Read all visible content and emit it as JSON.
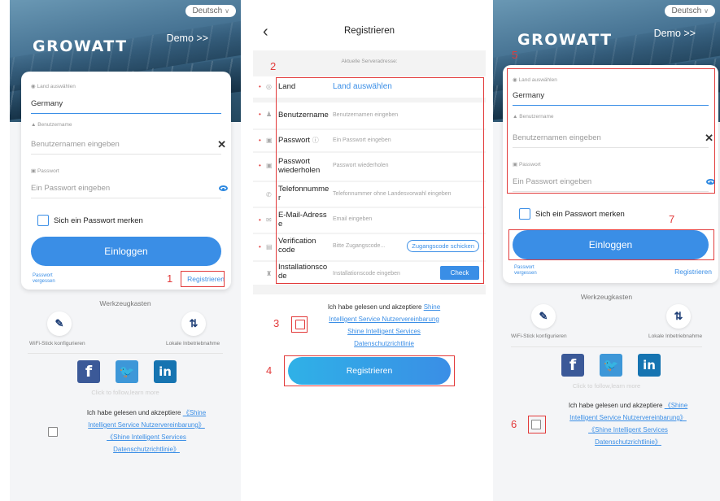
{
  "login": {
    "language": "Deutsch",
    "logo": "GROWATT",
    "demo": "Demo >>",
    "country_label": "Land auswählen",
    "country_value": "Germany",
    "username_label": "Benutzername",
    "username_placeholder": "Benutzernamen eingeben",
    "password_label": "Passwort",
    "password_placeholder": "Ein Passwort eingeben",
    "remember": "Sich ein Passwort merken",
    "login_button": "Einloggen",
    "forgot_line1": "Passwort",
    "forgot_line2": "vergessen",
    "register": "Registrieren",
    "tools_title": "Werkzeugkasten",
    "tool_wifi": "WiFi-Stick konfigurieren",
    "tool_local": "Lokale Inbetriebnahme",
    "follow": "Click to follow,learn more",
    "agree_line1_text": "Ich habe gelesen und akzeptiere",
    "agree_line1_link": "《Shine",
    "agree_line2": "Intelligent Service Nutzervereinbarung》",
    "agree_line3": "《Shine Intelligent Services",
    "agree_line4": "Datenschutzrichtlinie》"
  },
  "register_page": {
    "title": "Registrieren",
    "server": "Aktuelle Serveradresse:",
    "rows": [
      {
        "label": "Land",
        "value": "Land auswählen"
      },
      {
        "label": "Benutzername",
        "value": "Benutzernamen eingeben"
      },
      {
        "label": "Passwort",
        "value": "Ein Passwort eingeben"
      },
      {
        "label": "Passwort wiederholen",
        "value": "Passwort wiederholen"
      },
      {
        "label": "Telefonnummer",
        "value": "Telefonnummer ohne Landesvorwahl eingeben"
      },
      {
        "label": "E-Mail-Adresse",
        "value": "Email eingeben"
      },
      {
        "label": "Verification code",
        "value": "Bitte Zugangscode...",
        "button": "Zugangscode schicken"
      },
      {
        "label": "Installationscode",
        "value": "Installationscode eingeben",
        "button": "Check"
      }
    ],
    "agree_line1_text": "Ich habe gelesen und akzeptiere",
    "agree_line1_link": "Shine",
    "agree_line2": "Intelligent Service Nutzervereinbarung",
    "agree_line3": "Shine Intelligent Services",
    "agree_line4": "Datenschutzrichtlinie",
    "button": "Registrieren"
  },
  "annotations": [
    "1",
    "2",
    "3",
    "4",
    "5",
    "6",
    "7"
  ],
  "colors": {
    "accent": "#3a8ee6",
    "annotation": "#e23a3a"
  }
}
